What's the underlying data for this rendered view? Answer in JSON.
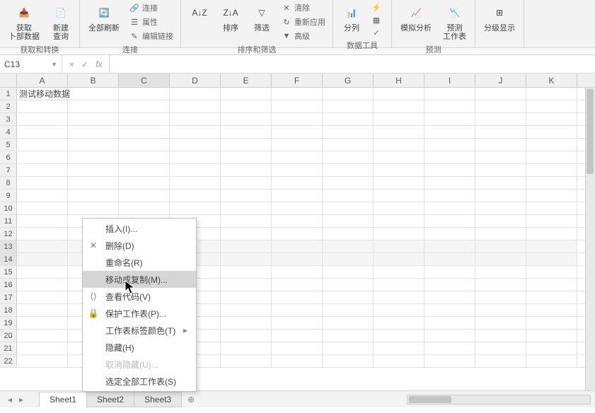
{
  "ribbon": {
    "groups": [
      {
        "label": "获取和转换",
        "big": [
          {
            "name": "get-external-data",
            "ico": "📥",
            "lbl": "获取\n卜部数据"
          },
          {
            "name": "new-query",
            "ico": "📄",
            "lbl": "新建\n查询"
          }
        ],
        "mini": []
      },
      {
        "label": "连接",
        "big": [
          {
            "name": "refresh-all",
            "ico": "🔄",
            "lbl": "全部刷新"
          }
        ],
        "mini": [
          {
            "name": "connections",
            "ico": "🔗",
            "lbl": "连接"
          },
          {
            "name": "properties",
            "ico": "☰",
            "lbl": "属性"
          },
          {
            "name": "edit-links",
            "ico": "✎",
            "lbl": "编辑链接"
          }
        ]
      },
      {
        "label": "排序和筛选",
        "big": [
          {
            "name": "sort-az",
            "ico": "A↓Z",
            "lbl": ""
          },
          {
            "name": "sort",
            "ico": "Z↓A",
            "lbl": "排序"
          },
          {
            "name": "filter",
            "ico": "▽",
            "lbl": "筛选"
          }
        ],
        "mini": [
          {
            "name": "clear",
            "ico": "✕",
            "lbl": "清除"
          },
          {
            "name": "reapply",
            "ico": "↻",
            "lbl": "重新应用"
          },
          {
            "name": "advanced",
            "ico": "▼",
            "lbl": "高级"
          }
        ]
      },
      {
        "label": "数据工具",
        "big": [
          {
            "name": "text-to-columns",
            "ico": "📊",
            "lbl": "分列"
          }
        ],
        "mini": [
          {
            "name": "flash-fill",
            "ico": "⚡",
            "lbl": ""
          },
          {
            "name": "remove-dup",
            "ico": "▦",
            "lbl": ""
          },
          {
            "name": "data-validation",
            "ico": "✓",
            "lbl": ""
          }
        ]
      },
      {
        "label": "预测",
        "big": [
          {
            "name": "what-if",
            "ico": "📈",
            "lbl": "模拟分析"
          },
          {
            "name": "forecast-sheet",
            "ico": "📉",
            "lbl": "预测\n工作表"
          }
        ],
        "mini": []
      },
      {
        "label": "",
        "big": [
          {
            "name": "outline",
            "ico": "⊞",
            "lbl": "分级显示"
          }
        ],
        "mini": []
      }
    ]
  },
  "namebox": "C13",
  "fx": {
    "fx_label": "fx",
    "value": ""
  },
  "columns": [
    "A",
    "B",
    "C",
    "D",
    "E",
    "F",
    "G",
    "H",
    "I",
    "J",
    "K"
  ],
  "sel_col": 2,
  "rows": 22,
  "sel_rows": [
    13,
    14
  ],
  "cells": {
    "A1": "测试移动数据"
  },
  "tabs": {
    "items": [
      "Sheet1",
      "Sheet2",
      "Sheet3"
    ],
    "active": 0
  },
  "context_menu": {
    "items": [
      {
        "name": "insert",
        "ico": "",
        "lbl": "插入(I)..."
      },
      {
        "name": "delete",
        "ico": "✕",
        "lbl": "删除(D)"
      },
      {
        "name": "rename",
        "ico": "",
        "lbl": "重命名(R)"
      },
      {
        "name": "move-copy",
        "ico": "",
        "lbl": "移动或复制(M)...",
        "hl": true
      },
      {
        "name": "view-code",
        "ico": "⟨⟩",
        "lbl": "查看代码(V)"
      },
      {
        "name": "protect",
        "ico": "🔒",
        "lbl": "保护工作表(P)..."
      },
      {
        "name": "tab-color",
        "ico": "",
        "lbl": "工作表标签颜色(T)",
        "arrow": true
      },
      {
        "name": "hide",
        "ico": "",
        "lbl": "隐藏(H)"
      },
      {
        "name": "unhide",
        "ico": "",
        "lbl": "取消隐藏(U)...",
        "disabled": true
      },
      {
        "name": "select-all",
        "ico": "",
        "lbl": "选定全部工作表(S)"
      }
    ]
  }
}
